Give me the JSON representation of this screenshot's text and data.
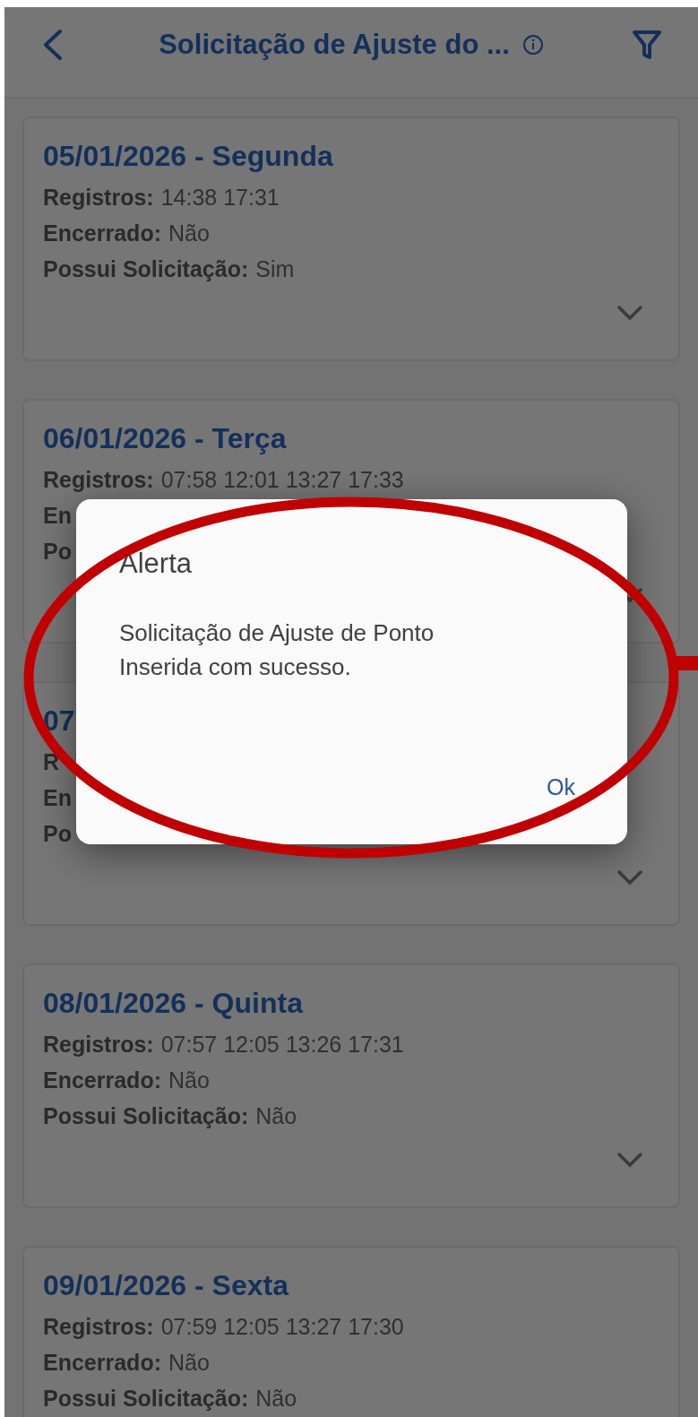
{
  "header": {
    "title": "Solicitação de Ajuste do ..."
  },
  "cards": [
    {
      "date": "05/01/2026 - Segunda",
      "expanded": false,
      "rows": [
        {
          "label": "Registros:",
          "value": "14:38 17:31"
        },
        {
          "label": "Encerrado:",
          "value": "Não"
        },
        {
          "label": "Possui Solicitação:",
          "value": "Sim"
        }
      ]
    },
    {
      "date": "06/01/2026 - Terça",
      "expanded": false,
      "rows": [
        {
          "label": "Registros:",
          "value": "07:58 12:01 13:27 17:33"
        },
        {
          "label": "En"
        },
        {
          "label": "Po"
        }
      ]
    },
    {
      "date": "07",
      "expanded": false,
      "rows": [
        {
          "label": "R"
        },
        {
          "label": "En"
        },
        {
          "label": "Po"
        }
      ]
    },
    {
      "date": "08/01/2026 - Quinta",
      "expanded": false,
      "rows": [
        {
          "label": "Registros:",
          "value": "07:57 12:05 13:26 17:31"
        },
        {
          "label": "Encerrado:",
          "value": "Não"
        },
        {
          "label": "Possui Solicitação:",
          "value": "Não"
        }
      ]
    },
    {
      "date": "09/01/2026 - Sexta",
      "rows": [
        {
          "label": "Registros:",
          "value": "07:59 12:05 13:27 17:30"
        },
        {
          "label": "Encerrado:",
          "value": "Não"
        },
        {
          "label": "Possui Solicitação:",
          "value": "Não"
        }
      ]
    }
  ],
  "dialog": {
    "title": "Alerta",
    "message": "Solicitação de Ajuste de Ponto Inserida com sucesso.",
    "buttons": [
      "Ok"
    ]
  }
}
